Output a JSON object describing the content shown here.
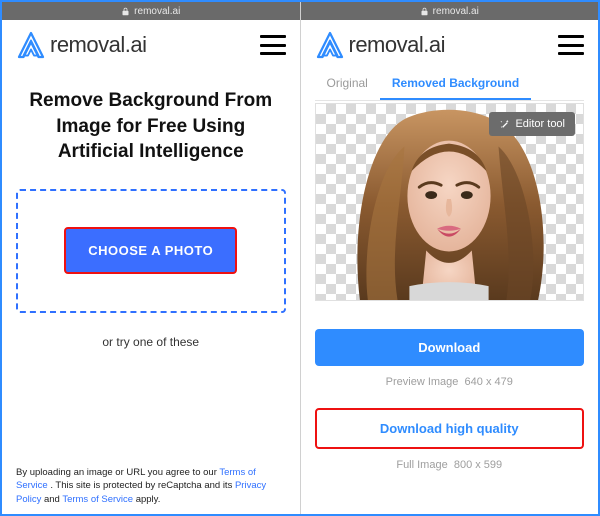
{
  "site": {
    "domain": "removal.ai",
    "brand": "removal.ai"
  },
  "left": {
    "headline": "Remove Background From Image for Free Using Artificial Intelligence",
    "choose_photo": "CHOOSE A PHOTO",
    "or_try": "or try one of these",
    "legal_prefix": "By uploading an image or URL you agree to our ",
    "tos": "Terms of Service",
    "legal_mid": " . This site is protected by reCaptcha and its ",
    "privacy": "Privacy Policy",
    "legal_and": " and ",
    "legal_apply": " apply."
  },
  "right": {
    "tabs": {
      "original": "Original",
      "removed": "Removed Background"
    },
    "editor_tool": "Editor tool",
    "download": "Download",
    "preview_label": "Preview Image",
    "preview_dim": "640 x 479",
    "download_hq": "Download high quality",
    "full_label": "Full Image",
    "full_dim": "800 x 599"
  }
}
